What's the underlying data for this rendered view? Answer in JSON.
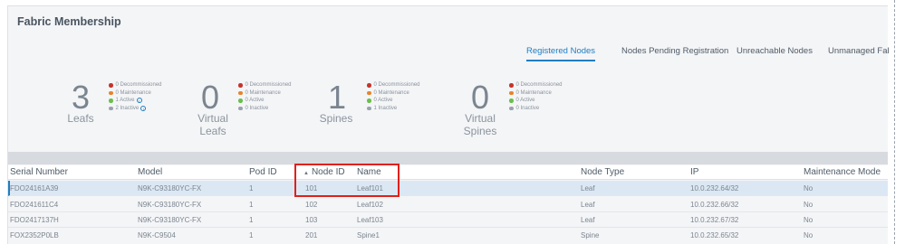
{
  "title": "Fabric Membership",
  "tabs": [
    {
      "label": "Registered Nodes",
      "active": true
    },
    {
      "label": "Nodes Pending Registration",
      "active": false
    },
    {
      "label": "Unreachable Nodes",
      "active": false
    },
    {
      "label": "Unmanaged Fabric",
      "active": false
    }
  ],
  "colors": {
    "decommissioned": "#c7342a",
    "maintenance": "#e8832d",
    "active": "#6abf4b",
    "inactive": "#9aa3ad",
    "accent": "#1f7ec0",
    "highlight": "#e0201a"
  },
  "stats": [
    {
      "count": "3",
      "label": "Leafs",
      "legend": [
        "0 Decommissioned",
        "0 Maintenance",
        "1 Active",
        "2 Inactive"
      ]
    },
    {
      "count": "0",
      "label": "Virtual Leafs",
      "legend": [
        "0 Decommissioned",
        "0 Maintenance",
        "0 Active",
        "0 Inactive"
      ]
    },
    {
      "count": "1",
      "label": "Spines",
      "legend": [
        "0 Decommissioned",
        "0 Maintenance",
        "0 Active",
        "1 Inactive"
      ]
    },
    {
      "count": "0",
      "label": "Virtual Spines",
      "legend": [
        "0 Decommissioned",
        "0 Maintenance",
        "0 Active",
        "0 Inactive"
      ]
    }
  ],
  "table": {
    "columns": [
      "Serial Number",
      "Model",
      "Pod ID",
      "Node ID",
      "Name",
      "Node Type",
      "IP",
      "Maintenance Mode"
    ],
    "sort_icon": "sort-ascending-icon",
    "rows": [
      [
        "FDO24161A39",
        "N9K-C93180YC-FX",
        "1",
        "101",
        "Leaf101",
        "Leaf",
        "10.0.232.64/32",
        "No"
      ],
      [
        "FDO241611C4",
        "N9K-C93180YC-FX",
        "1",
        "102",
        "Leaf102",
        "Leaf",
        "10.0.232.66/32",
        "No"
      ],
      [
        "FDO2417137H",
        "N9K-C93180YC-FX",
        "1",
        "103",
        "Leaf103",
        "Leaf",
        "10.0.232.67/32",
        "No"
      ],
      [
        "FOX2352P0LB",
        "N9K-C9504",
        "1",
        "201",
        "Spine1",
        "Spine",
        "10.0.232.65/32",
        "No"
      ]
    ]
  }
}
